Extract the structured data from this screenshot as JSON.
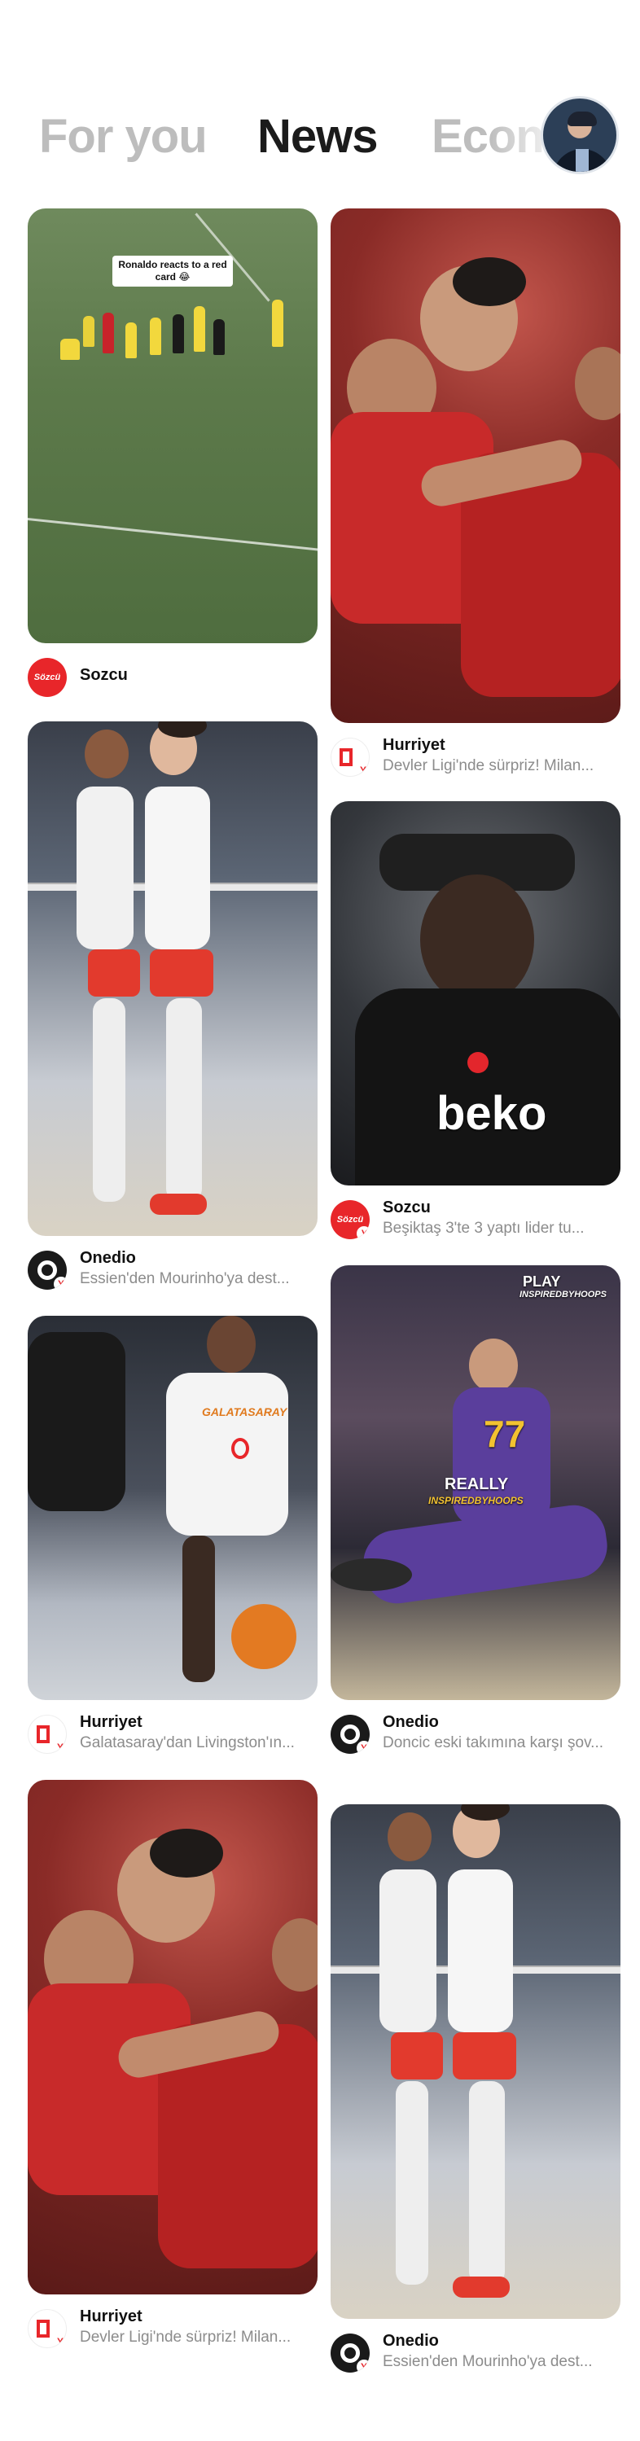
{
  "tabs": [
    {
      "label": "For you",
      "active": false
    },
    {
      "label": "News",
      "active": true
    },
    {
      "label": "Econ",
      "active": false
    }
  ],
  "profile": {
    "icon": "user-avatar"
  },
  "cards": [
    {
      "id": "c1",
      "source": "Sozcu",
      "headline": "",
      "logo": "sozcu",
      "image_caption": "Ronaldo reacts to a red card 😂"
    },
    {
      "id": "c2",
      "source": "Hurriyet",
      "headline": "Devler Ligi'nde sürpriz! Milan...",
      "logo": "hurriyet"
    },
    {
      "id": "c3",
      "source": "Onedio",
      "headline": "Essien'den Mourinho'ya dest...",
      "logo": "onedio"
    },
    {
      "id": "c4",
      "source": "Sozcu",
      "headline": "Beşiktaş 3'te 3 yaptı lider tu...",
      "logo": "sozcu",
      "image_text": "beko"
    },
    {
      "id": "c5",
      "source": "Hurriyet",
      "headline": "Galatasaray'dan Livingston'ın...",
      "logo": "hurriyet",
      "image_text": "GALATASARAY"
    },
    {
      "id": "c6",
      "source": "Onedio",
      "headline": "Doncic eski takımına karşı şov...",
      "logo": "onedio",
      "image_text_1": "PLAY",
      "image_text_2": "INSPIREDBYHOOPS",
      "image_text_3": "REALLY",
      "image_text_4": "INSPIREDBYHOOPS",
      "jersey": "77"
    },
    {
      "id": "c7",
      "source": "Hurriyet",
      "headline": "Devler Ligi'nde sürpriz! Milan...",
      "logo": "hurriyet"
    },
    {
      "id": "c8",
      "source": "Onedio",
      "headline": "Essien'den Mourinho'ya dest...",
      "logo": "onedio"
    }
  ],
  "colors": {
    "active_tab": "#1b1b1b",
    "inactive_tab": "#bdbdbd",
    "brand_red": "#e8262a"
  }
}
